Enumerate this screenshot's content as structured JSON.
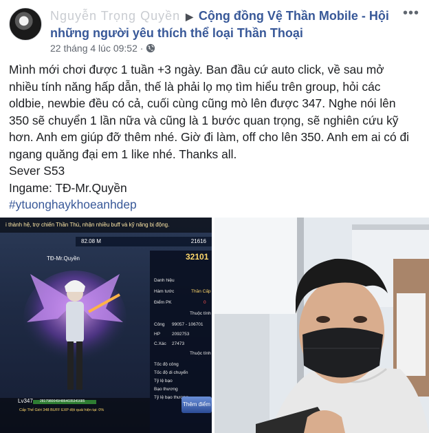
{
  "header": {
    "author_name_masked": "Nguyễn Trọng Quyền",
    "arrow": "▶",
    "group_name": "Cộng đồng Vệ Thần Mobile - Hội những người yêu thích thể loại Thần Thoại",
    "timestamp": "22 tháng 4 lúc 09:52 ·",
    "more_label": "•••"
  },
  "body": {
    "lines": [
      "Mình mới chơi được 1 tuần +3 ngày. Ban đầu cứ auto click, về sau mở",
      "nhiều tính năng hấp dẫn, thế là phải lọ mọ tìm hiểu trên group, hỏi các",
      "oldbie, newbie đều có cả, cuối cùng cũng mò lên được 347. Nghe nói lên",
      "350 sẽ chuyển 1 lần nữa và cũng là 1 bước quan trọng, sẽ nghiên cứu kỹ",
      "hơn. Anh em giúp đỡ thêm nhé. Giờ đi làm, off cho lên 350. Anh em ai có đi",
      "ngang quăng đại em 1 like nhé. Thanks all.",
      "Sever S53",
      "Ingame: TĐ-Mr.Quyền"
    ],
    "hashtag": "#ytuonghaykhoeanhdep"
  },
  "game": {
    "top_text": "i thành hệ, trợ chiến Thần Thú, nhận nhiều buff và kỹ năng bị động.",
    "gold": "82.08 M",
    "gems": "21616",
    "char_name": "TĐ-Mr.Quyền",
    "score": "32101",
    "stats": [
      "Danh hiệu",
      "Hàm tước",
      "Thần Cấp",
      "Điểm PK",
      "0",
      "Thuộc tính",
      "Công",
      "99057 - 106701",
      "HP",
      "2092753",
      "C.Xác",
      "27473",
      "Thuộc tính",
      "Tốc độ công",
      "Tốc độ di chuyển",
      "Tỷ lệ bạo",
      "Bạo thương",
      "Tỷ lệ bạo thương"
    ],
    "level": "Lv347",
    "exp": "2817980049/4864035341685",
    "daily": "Cấp Thế Giới 348 BUFF EXP đột quái hiện tại: 0%",
    "button": "Thêm điểm"
  }
}
